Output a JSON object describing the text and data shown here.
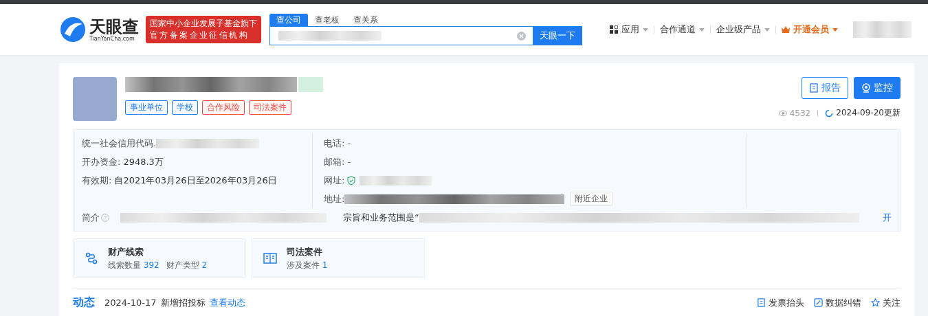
{
  "header": {
    "logo": {
      "name": "天眼查",
      "domain": "TianYanCha.com"
    },
    "banner": [
      "国家中小企业发展子基金旗下",
      "官方备案企业征信机构"
    ],
    "search_tabs": [
      {
        "label": "查公司",
        "selected": true
      },
      {
        "label": "查老板",
        "selected": false
      },
      {
        "label": "查关系",
        "selected": false
      }
    ],
    "search_button": "天眼一下",
    "nav": [
      {
        "label": "应用",
        "kind": "apps"
      },
      {
        "label": "合作通道",
        "kind": "plain"
      },
      {
        "label": "企业级产品",
        "kind": "plain"
      },
      {
        "label": "开通会员",
        "kind": "vip"
      }
    ]
  },
  "company": {
    "tags": [
      {
        "label": "事业单位",
        "color": "#1f7cf0"
      },
      {
        "label": "学校",
        "color": "#1f7cf0"
      },
      {
        "label": "合作风险",
        "color": "#f04a3e"
      },
      {
        "label": "司法案件",
        "color": "#f04a3e"
      }
    ],
    "buttons": [
      {
        "label": "报告",
        "kind": "outline"
      },
      {
        "label": "监控",
        "kind": "primary"
      }
    ],
    "views": "4532",
    "updated": "2024-09-20更新"
  },
  "info": {
    "left": [
      {
        "label": "统一社会信用代码."
      },
      {
        "label": "开办资金:",
        "value": "2948.3万"
      },
      {
        "label": "有效期:",
        "value": "自2021年03月26日至2026年03月26日"
      }
    ],
    "right": [
      {
        "label": "电话: -",
        "kind": "text"
      },
      {
        "label": "邮箱: -",
        "kind": "text"
      },
      {
        "label": "网址:",
        "kind": "site"
      },
      {
        "label": "地址:",
        "kind": "address"
      }
    ],
    "nearby": "附近企业",
    "intro_label": "简介",
    "intro_mid": "宗旨和业务范围是“",
    "expand": "开"
  },
  "cards": [
    {
      "title": "财产线索",
      "kind": "clue",
      "stats": [
        {
          "label": "线索数量",
          "value": "392"
        },
        {
          "label": "财产类型",
          "value": "2"
        }
      ]
    },
    {
      "title": "司法案件",
      "kind": "book",
      "stats": [
        {
          "label": "涉及案件",
          "value": "1"
        }
      ]
    }
  ],
  "dynamics": {
    "title": "动态",
    "date": "2024-10-17",
    "text": "新增招投标",
    "link": "查看动态",
    "actions": [
      {
        "label": "发票抬头",
        "kind": "invoice"
      },
      {
        "label": "数据纠错",
        "kind": "fix"
      },
      {
        "label": "关注",
        "kind": "star"
      }
    ]
  }
}
